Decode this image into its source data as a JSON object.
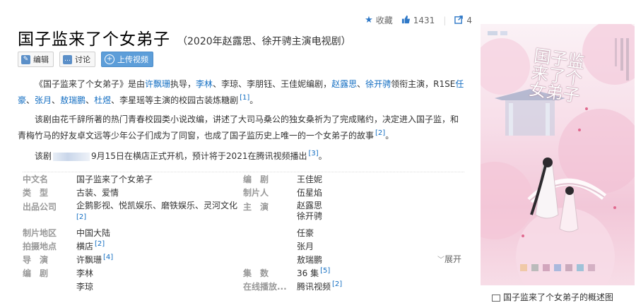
{
  "stats": {
    "favorite_label": "收藏",
    "likes": "1431",
    "shares": "4"
  },
  "header": {
    "title": "国子监来了个女弟子",
    "subtitle": "（2020年赵露思、徐开骋主演电视剧）"
  },
  "buttons": {
    "edit": "编辑",
    "discuss": "讨论",
    "upload": "上传视频"
  },
  "intro": {
    "p1": {
      "t1": "《国子监来了个女弟子》是由",
      "director": "许飘珊",
      "t2": "执导，",
      "w1": "李林",
      "t3": "、李琼、李朋钰、王佳妮编剧，",
      "a1": "赵露思",
      "t4": "、",
      "a2": "徐开骋",
      "t5": "领衔主演，R1SE",
      "a3": "任豪",
      "t6": "、",
      "a4": "张月",
      "t7": "、",
      "a5": "敖瑞鹏",
      "t8": "、",
      "a6": "杜煜",
      "t9": "、李星瑶等主演的校园古装炼糖剧",
      "ref": "[1]",
      "end": "。"
    },
    "p2": {
      "text": "该剧由花千辞所著的热门青春校园类小说改编，讲述了大司马桑公的独女桑祈为了完成赌约，决定进入国子监，和青梅竹马的好友卓文远等少年公子们成为了同窗，也成了国子监历史上唯一的一个女弟子的故事",
      "ref": "[2]",
      "end": "。"
    },
    "p3": {
      "t1": "该剧",
      "t2": "9月15日在横店正式开机，预计将于2021在腾讯视频播出",
      "ref": "[3]",
      "end": "。"
    }
  },
  "infobox": {
    "expand": "展开",
    "rows": [
      {
        "l_label": "中文名",
        "l_value": "国子监来了个女弟子",
        "r_label": "编　剧",
        "r_value": "王佳妮"
      },
      {
        "l_label": "类　型",
        "l_value": "古装、爱情",
        "r_label": "制片人",
        "r_value": "伍星焰"
      },
      {
        "l_label": "出品公司",
        "l_value": "企鹅影视、悦凯娱乐、磨铁娱乐、灵河文化",
        "l_ref": "[2]",
        "r_label": "主　演",
        "r_value": "赵露思",
        "r_value2": "徐开骋"
      },
      {
        "l_label": "制片地区",
        "l_value": "中国大陆",
        "r_label": "",
        "r_value": "任豪"
      },
      {
        "l_label": "拍摄地点",
        "l_value": "横店",
        "l_ref": "[2]",
        "r_label": "",
        "r_value": "张月"
      },
      {
        "l_label": "导　演",
        "l_value": "许飘珊",
        "l_ref": "[4]",
        "r_label": "",
        "r_value": "敖瑞鹏"
      },
      {
        "l_label": "编　剧",
        "l_value": "李林",
        "r_label": "集　数",
        "r_value": "36 集",
        "r_ref": "[5]"
      },
      {
        "l_label": "",
        "l_value": "李琼",
        "r_label": "在线播放...",
        "r_value": "腾讯视频",
        "r_ref": "[2]"
      }
    ]
  },
  "poster": {
    "art_title": "国子监来了个女弟子",
    "caption": "国子监来了个女弟子的概述图"
  },
  "colors": {
    "link": "#136ec2",
    "label": "#999999",
    "upload_button": "#5d9ed9",
    "poster_pink": "#f2c7d8"
  }
}
